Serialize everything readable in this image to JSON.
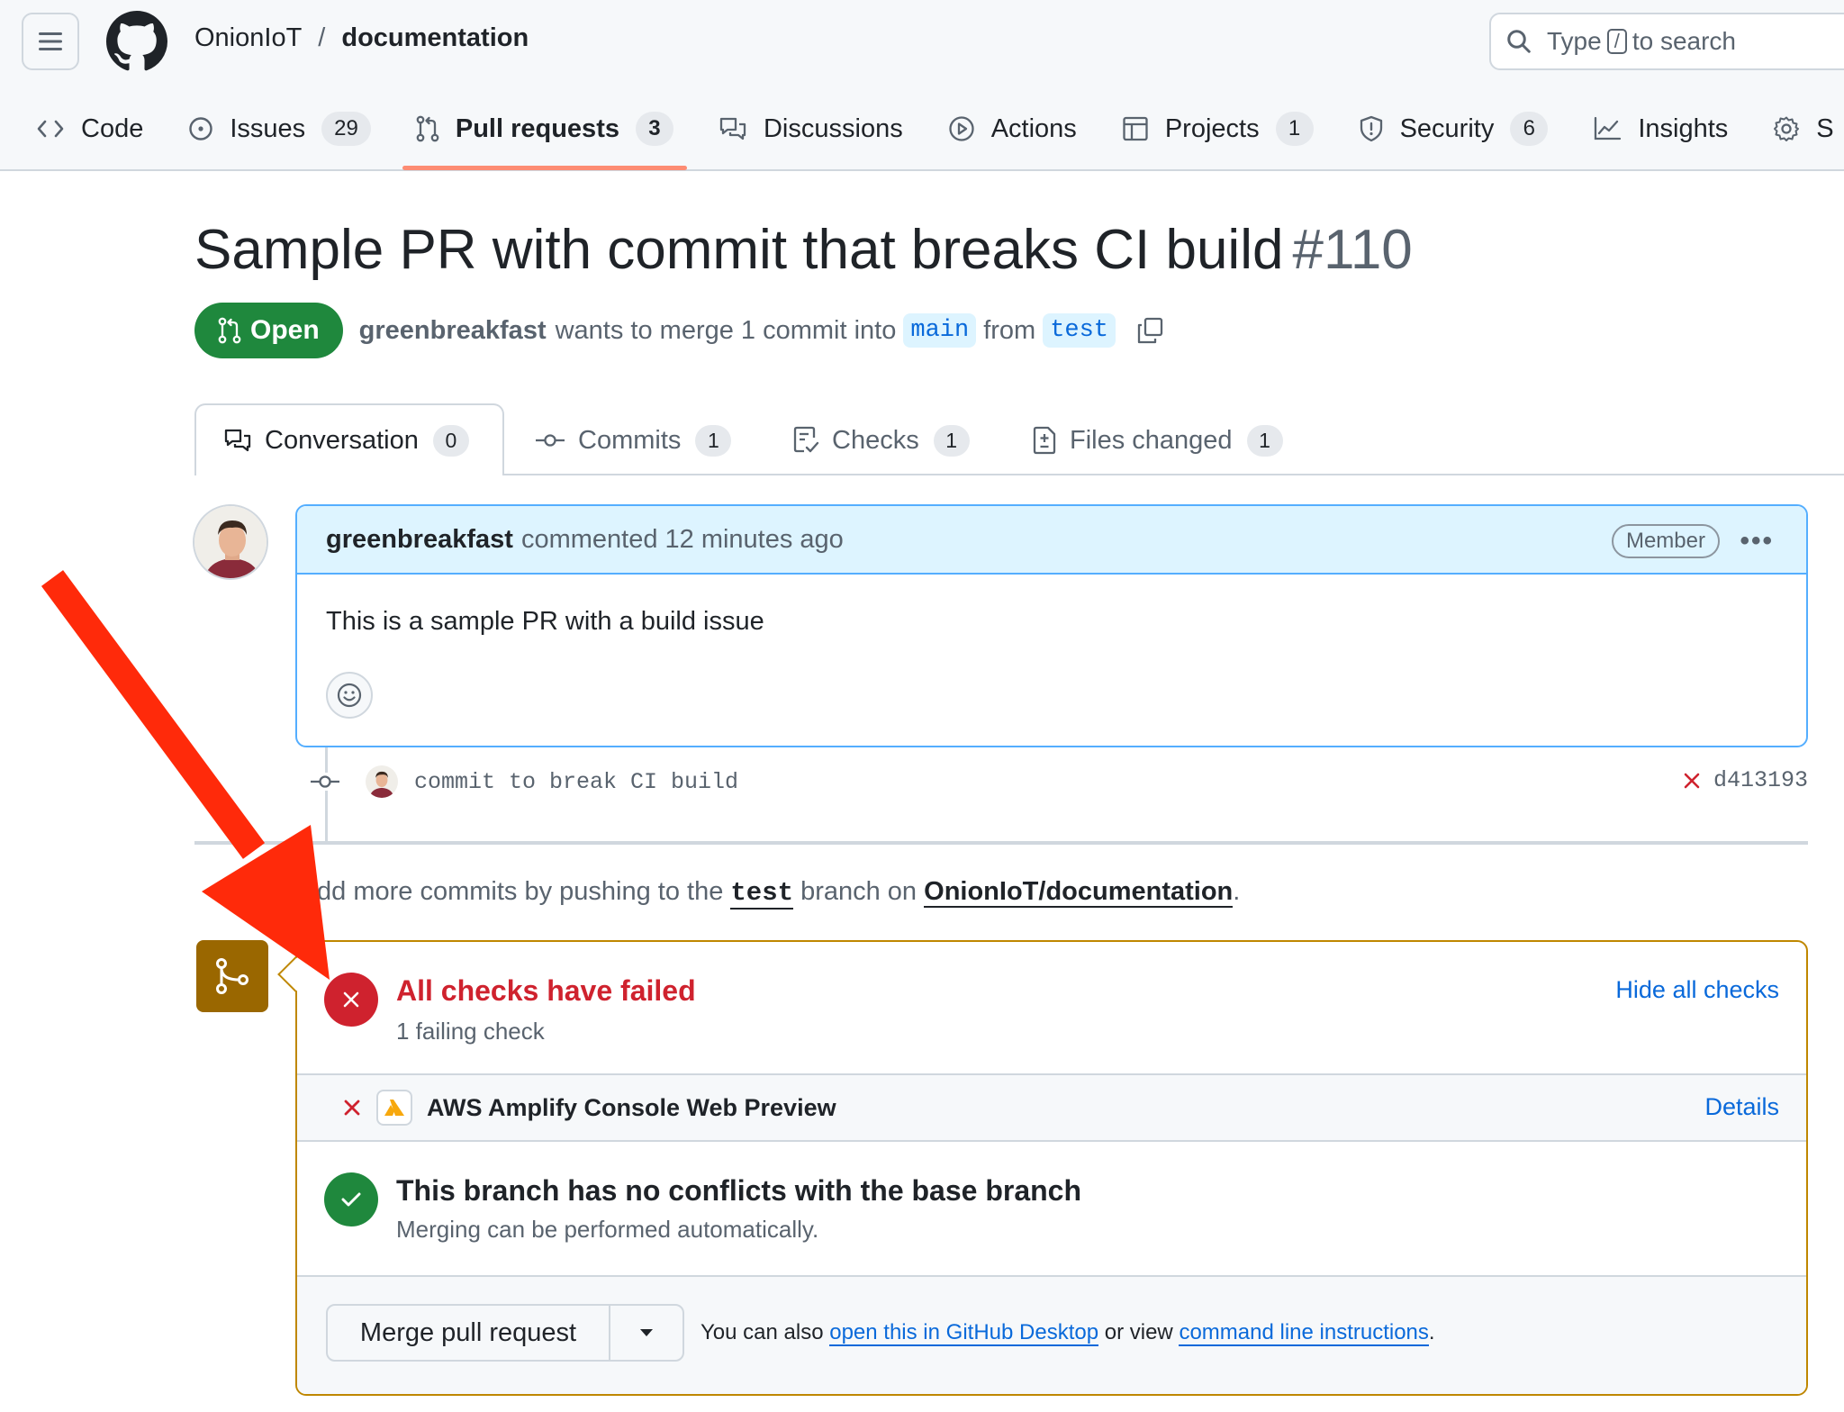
{
  "header": {
    "owner": "OnionIoT",
    "separator": "/",
    "repo": "documentation",
    "search_prefix": "Type",
    "search_key": "/",
    "search_suffix": "to search"
  },
  "nav": {
    "code": "Code",
    "issues": "Issues",
    "issues_count": "29",
    "pulls": "Pull requests",
    "pulls_count": "3",
    "discussions": "Discussions",
    "actions": "Actions",
    "projects": "Projects",
    "projects_count": "1",
    "security": "Security",
    "security_count": "6",
    "insights": "Insights",
    "settings_cut": "S"
  },
  "pr": {
    "title": "Sample PR with commit that breaks CI build",
    "number": "#110",
    "state": "Open",
    "author": "greenbreakfast",
    "wants_text": "wants to merge 1 commit into",
    "base": "main",
    "from_text": "from",
    "head": "test"
  },
  "tabs": {
    "conversation": "Conversation",
    "conversation_count": "0",
    "commits": "Commits",
    "commits_count": "1",
    "checks": "Checks",
    "checks_count": "1",
    "files": "Files changed",
    "files_count": "1"
  },
  "comment": {
    "author": "greenbreakfast",
    "when": "commented 12 minutes ago",
    "badge": "Member",
    "menu": "•••",
    "body": "This is a sample PR with a build issue"
  },
  "commit": {
    "message": "commit to break CI build",
    "sha": "d413193"
  },
  "push_hint": {
    "prefix": "dd more commits by pushing to the",
    "branch": "test",
    "middle": "branch on",
    "repo_link": "OnionIoT/documentation",
    "suffix": "."
  },
  "merge_box": {
    "fail_title": "All checks have failed",
    "fail_sub": "1 failing check",
    "hide_checks": "Hide all checks",
    "check_name": "AWS Amplify Console Web Preview",
    "details": "Details",
    "ok_title": "This branch has no conflicts with the base branch",
    "ok_sub": "Merging can be performed automatically.",
    "merge_button": "Merge pull request",
    "hint_prefix": "You can also",
    "hint_link1": "open this in GitHub Desktop",
    "hint_middle": "or view",
    "hint_link2": "command line instructions",
    "hint_suffix": "."
  },
  "colors": {
    "open_green": "#1f883d",
    "fail_red": "#cf222e",
    "link_blue": "#0969da",
    "merge_border": "#bf8700",
    "merge_icon_bg": "#9a6700",
    "annotation_arrow": "#ff2a0a"
  }
}
